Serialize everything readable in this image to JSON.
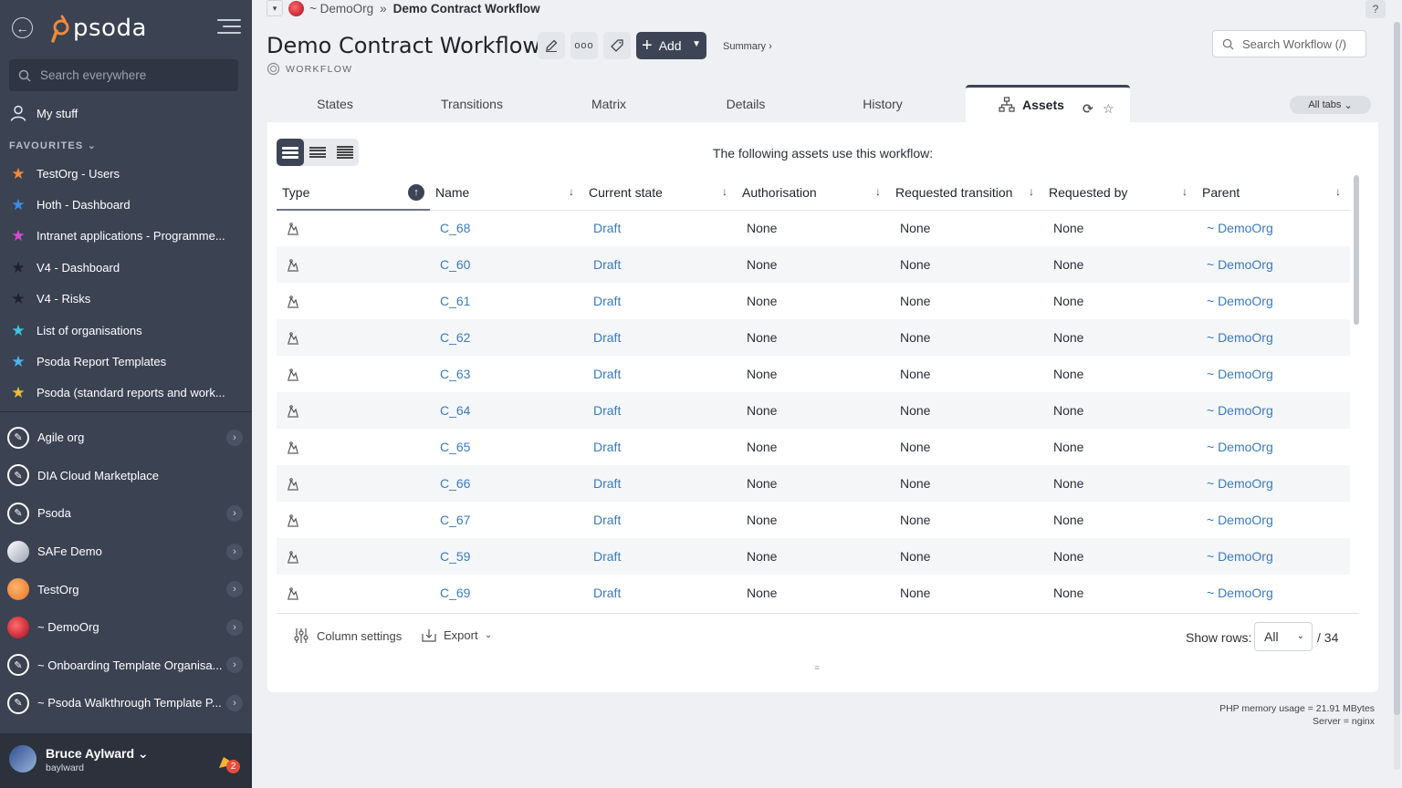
{
  "sidebar": {
    "logo_text": "psoda",
    "search_placeholder": "Search everywhere",
    "my_stuff": "My stuff",
    "favourites_title": "FAVOURITES",
    "favourites": [
      {
        "label": "TestOrg - Users",
        "color": "#f08a3c"
      },
      {
        "label": "Hoth - Dashboard",
        "color": "#3d8be6"
      },
      {
        "label": "Intranet applications - Programme...",
        "color": "#d94bd0"
      },
      {
        "label": "V4 - Dashboard",
        "color": "#1f2329"
      },
      {
        "label": "V4 - Risks",
        "color": "#1f2329"
      },
      {
        "label": "List of organisations",
        "color": "#3ec6d9"
      },
      {
        "label": "Psoda Report Templates",
        "color": "#4fb3e8"
      },
      {
        "label": "Psoda (standard reports and work...",
        "color": "#e8c13a"
      }
    ],
    "orgs": [
      {
        "label": "Agile org",
        "has_children": true
      },
      {
        "label": "DIA Cloud Marketplace",
        "has_children": false
      },
      {
        "label": "Psoda",
        "has_children": true
      },
      {
        "label": "SAFe Demo",
        "has_children": true
      },
      {
        "label": "TestOrg",
        "has_children": true
      },
      {
        "label": "~ DemoOrg",
        "has_children": true
      },
      {
        "label": "~ Onboarding Template Organisa...",
        "has_children": true
      },
      {
        "label": "~ Psoda Walkthrough Template P...",
        "has_children": true
      }
    ],
    "user": {
      "name": "Bruce Aylward",
      "login": "baylward",
      "notifications": "2"
    }
  },
  "breadcrumb": {
    "org": "~ DemoOrg",
    "separator": "»",
    "current": "Demo Contract Workflow"
  },
  "header": {
    "title": "Demo Contract Workflow",
    "subtitle": "WORKFLOW",
    "add_label": "Add",
    "summary_link": "Summary ›",
    "search_placeholder": "Search Workflow (/)",
    "help": "?"
  },
  "tabs": [
    {
      "label": "States"
    },
    {
      "label": "Transitions"
    },
    {
      "label": "Matrix"
    },
    {
      "label": "Details"
    },
    {
      "label": "History"
    },
    {
      "label": "Assets",
      "active": true
    }
  ],
  "all_tabs_label": "All tabs",
  "card": {
    "heading": "The following assets use this workflow:",
    "columns": [
      "Type",
      "Name",
      "Current state",
      "Authorisation",
      "Requested transition",
      "Requested by",
      "Parent"
    ],
    "rows": [
      {
        "name": "C_68",
        "state": "Draft",
        "auth": "None",
        "req_trans": "None",
        "req_by": "None",
        "parent": "~ DemoOrg"
      },
      {
        "name": "C_60",
        "state": "Draft",
        "auth": "None",
        "req_trans": "None",
        "req_by": "None",
        "parent": "~ DemoOrg"
      },
      {
        "name": "C_61",
        "state": "Draft",
        "auth": "None",
        "req_trans": "None",
        "req_by": "None",
        "parent": "~ DemoOrg"
      },
      {
        "name": "C_62",
        "state": "Draft",
        "auth": "None",
        "req_trans": "None",
        "req_by": "None",
        "parent": "~ DemoOrg"
      },
      {
        "name": "C_63",
        "state": "Draft",
        "auth": "None",
        "req_trans": "None",
        "req_by": "None",
        "parent": "~ DemoOrg"
      },
      {
        "name": "C_64",
        "state": "Draft",
        "auth": "None",
        "req_trans": "None",
        "req_by": "None",
        "parent": "~ DemoOrg"
      },
      {
        "name": "C_65",
        "state": "Draft",
        "auth": "None",
        "req_trans": "None",
        "req_by": "None",
        "parent": "~ DemoOrg"
      },
      {
        "name": "C_66",
        "state": "Draft",
        "auth": "None",
        "req_trans": "None",
        "req_by": "None",
        "parent": "~ DemoOrg"
      },
      {
        "name": "C_67",
        "state": "Draft",
        "auth": "None",
        "req_trans": "None",
        "req_by": "None",
        "parent": "~ DemoOrg"
      },
      {
        "name": "C_59",
        "state": "Draft",
        "auth": "None",
        "req_trans": "None",
        "req_by": "None",
        "parent": "~ DemoOrg"
      },
      {
        "name": "C_69",
        "state": "Draft",
        "auth": "None",
        "req_trans": "None",
        "req_by": "None",
        "parent": "~ DemoOrg"
      }
    ],
    "column_settings": "Column settings",
    "export": "Export",
    "show_rows_label": "Show rows:",
    "show_rows_value": "All",
    "total": "/ 34"
  },
  "footer": {
    "memory": "PHP memory usage = 21.91 MBytes",
    "server": "Server = nginx"
  },
  "colors": {
    "sidebar": "#3b4252",
    "accent": "#3c4456",
    "link": "#3a7bbf"
  }
}
